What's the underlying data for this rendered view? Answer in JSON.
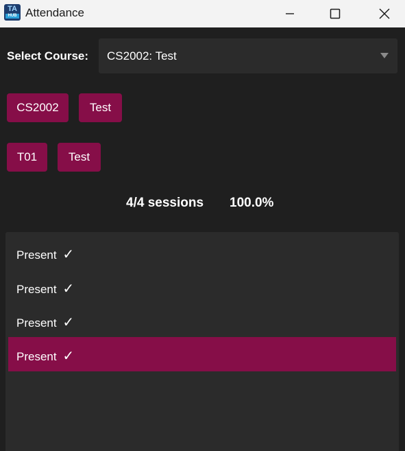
{
  "window": {
    "title": "Attendance",
    "icon_text": "TA",
    "icon_subtext": "HUB"
  },
  "course": {
    "label": "Select Course:",
    "selected": "CS2002: Test"
  },
  "chips": {
    "course_code": "CS2002",
    "course_name": "Test",
    "group_code": "T01",
    "group_name": "Test"
  },
  "stats": {
    "sessions": "4/4 sessions",
    "percent": "100.0%"
  },
  "attendance": [
    {
      "status": "Present",
      "mark": "✓",
      "selected": false
    },
    {
      "status": "Present",
      "mark": "✓",
      "selected": false
    },
    {
      "status": "Present",
      "mark": "✓",
      "selected": false
    },
    {
      "status": "Present",
      "mark": "✓",
      "selected": true
    }
  ],
  "colors": {
    "accent": "#860e48",
    "background": "#1f1f1f",
    "panel": "#2b2b2b",
    "titlebar": "#f3f3f3"
  }
}
